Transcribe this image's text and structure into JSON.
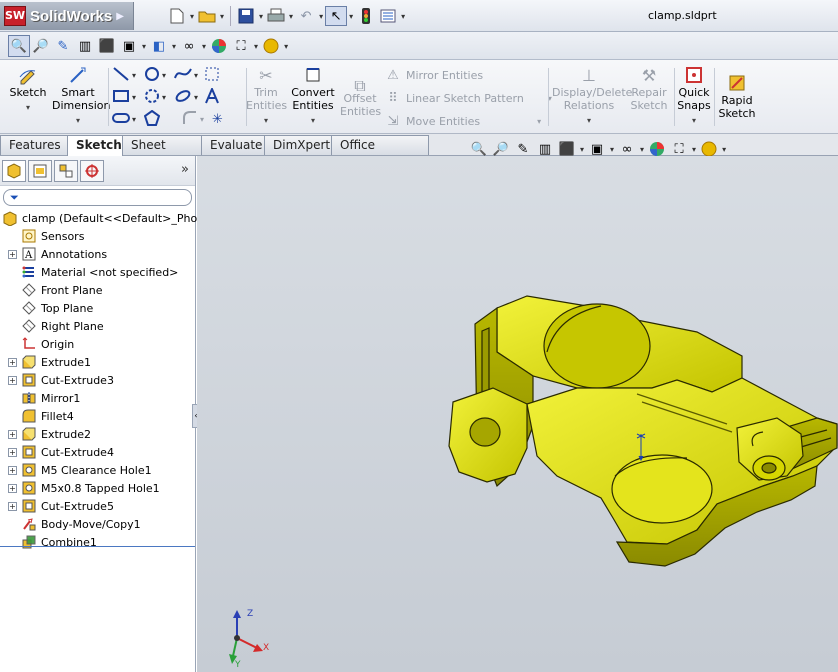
{
  "app": {
    "brand_initials": "SW",
    "brand_name": "SolidWorks",
    "document_title": "clamp.sldprt"
  },
  "quick_access": [
    {
      "name": "new-file-icon",
      "glyph": "🗋"
    },
    {
      "name": "open-file-icon",
      "glyph": "📂"
    },
    {
      "name": "save-icon",
      "glyph": "💾"
    },
    {
      "name": "print-icon",
      "glyph": "🖶"
    },
    {
      "name": "undo-icon",
      "glyph": "↶"
    },
    {
      "name": "select-icon",
      "glyph": "↖"
    },
    {
      "name": "rebuild-icon",
      "glyph": "🚦"
    },
    {
      "name": "options-icon",
      "glyph": "☰"
    }
  ],
  "command_manager": {
    "sketch": "Sketch",
    "smart_dimension_l1": "Smart",
    "smart_dimension_l2": "Dimension",
    "trim_l1": "Trim",
    "trim_l2": "Entities",
    "convert_l1": "Convert",
    "convert_l2": "Entities",
    "offset_l1": "Offset",
    "offset_l2": "Entities",
    "mirror_entities": "Mirror Entities",
    "linear_pattern": "Linear Sketch Pattern",
    "move_entities": "Move Entities",
    "display_delete_l1": "Display/Delete",
    "display_delete_l2": "Relations",
    "repair_l1": "Repair",
    "repair_l2": "Sketch",
    "quick_snaps_l1": "Quick",
    "quick_snaps_l2": "Snaps",
    "rapid_sketch_l1": "Rapid",
    "rapid_sketch_l2": "Sketch"
  },
  "tabs": [
    {
      "label": "Features",
      "active": false
    },
    {
      "label": "Sketch",
      "active": true
    },
    {
      "label": "Sheet Metal",
      "active": false
    },
    {
      "label": "Evaluate",
      "active": false
    },
    {
      "label": "DimXpert",
      "active": false
    },
    {
      "label": "Office Products",
      "active": false
    }
  ],
  "feature_tree": {
    "root": "clamp  (Default<<Default>_PhotoV",
    "items": [
      {
        "label": "Sensors",
        "expandable": false,
        "icon": "sensor-icon"
      },
      {
        "label": "Annotations",
        "expandable": true,
        "icon": "annotations-icon"
      },
      {
        "label": "Material <not specified>",
        "expandable": false,
        "icon": "material-icon"
      },
      {
        "label": "Front Plane",
        "expandable": false,
        "icon": "plane-icon"
      },
      {
        "label": "Top Plane",
        "expandable": false,
        "icon": "plane-icon"
      },
      {
        "label": "Right Plane",
        "expandable": false,
        "icon": "plane-icon"
      },
      {
        "label": "Origin",
        "expandable": false,
        "icon": "origin-icon"
      },
      {
        "label": "Extrude1",
        "expandable": true,
        "icon": "extrude-icon"
      },
      {
        "label": "Cut-Extrude3",
        "expandable": true,
        "icon": "cut-extrude-icon"
      },
      {
        "label": "Mirror1",
        "expandable": false,
        "icon": "mirror-icon"
      },
      {
        "label": "Fillet4",
        "expandable": false,
        "icon": "fillet-icon"
      },
      {
        "label": "Extrude2",
        "expandable": true,
        "icon": "extrude-icon"
      },
      {
        "label": "Cut-Extrude4",
        "expandable": true,
        "icon": "cut-extrude-icon"
      },
      {
        "label": "M5 Clearance Hole1",
        "expandable": true,
        "icon": "hole-icon"
      },
      {
        "label": "M5x0.8 Tapped Hole1",
        "expandable": true,
        "icon": "hole-icon"
      },
      {
        "label": "Cut-Extrude5",
        "expandable": true,
        "icon": "cut-extrude-icon"
      },
      {
        "label": "Body-Move/Copy1",
        "expandable": false,
        "icon": "move-body-icon"
      },
      {
        "label": "Combine1",
        "expandable": false,
        "icon": "combine-icon"
      }
    ]
  },
  "triad": {
    "x": "X",
    "y": "Y",
    "z": "Z"
  },
  "colors": {
    "part": "#c8c800",
    "viewport_top": "#d8dde3",
    "viewport_bottom": "#c6ccd4",
    "brand_red": "#c8202a"
  }
}
